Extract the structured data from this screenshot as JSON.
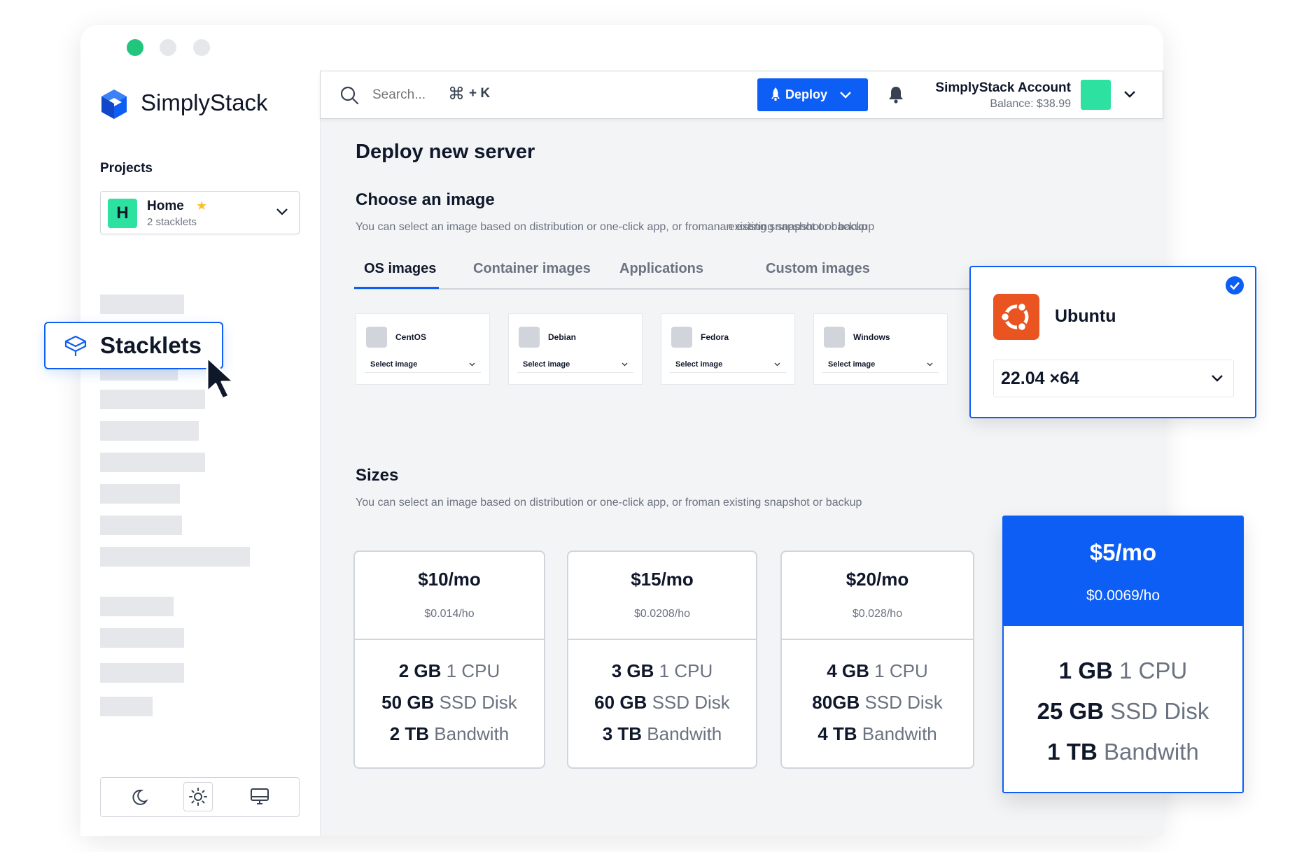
{
  "brand": {
    "name": "SimplyStack",
    "accent": "#0d5ef5",
    "green": "#2de1a0"
  },
  "sidebar": {
    "projects_heading": "Projects",
    "project": {
      "initial": "H",
      "name": "Home",
      "subtitle": "2 stacklets"
    },
    "active_item": "Stacklets",
    "theme_buttons": [
      "moon-icon",
      "sun-icon",
      "monitor-icon"
    ]
  },
  "topbar": {
    "search_placeholder": "Search...",
    "shortcut": "+ K",
    "deploy_label": "Deploy",
    "account_name": "SimplyStack Account",
    "balance": "Balance: $38.99"
  },
  "page": {
    "title": "Deploy new server",
    "image_section": {
      "heading": "Choose an image",
      "description_main": "You can select an image based on distribution or one-click app, or froman",
      "description_overlap_a": "an existing snapshot or backup",
      "description_overlap_b": "existing snapshot or backup",
      "tabs": [
        "OS images",
        "Container images",
        "Applications",
        "Custom images"
      ],
      "active_tab": "OS images",
      "os_options": [
        {
          "name": "CentOS",
          "select_label": "Select image"
        },
        {
          "name": "Debian",
          "select_label": "Select image"
        },
        {
          "name": "Fedora",
          "select_label": "Select image"
        },
        {
          "name": "Windows",
          "select_label": "Select image"
        }
      ],
      "selected_image": {
        "name": "Ubuntu",
        "version": "22.04 ×64"
      }
    },
    "sizes_section": {
      "heading": "Sizes",
      "description": "You can select an image based on distribution or one-click app, or froman existing snapshot or backup",
      "plans": [
        {
          "price": "$10/mo",
          "hourly": "$0.014/ho",
          "ram": "2 GB",
          "cpu": "1 CPU",
          "disk": "50 GB",
          "disk_label": "SSD Disk",
          "bw": "2 TB",
          "bw_label": "Bandwith"
        },
        {
          "price": "$15/mo",
          "hourly": "$0.0208/ho",
          "ram": "3 GB",
          "cpu": "1 CPU",
          "disk": "60 GB",
          "disk_label": "SSD Disk",
          "bw": "3 TB",
          "bw_label": "Bandwith"
        },
        {
          "price": "$20/mo",
          "hourly": "$0.028/ho",
          "ram": "4 GB",
          "cpu": "1 CPU",
          "disk": "80GB",
          "disk_label": "SSD Disk",
          "bw": "4 TB",
          "bw_label": "Bandwith"
        }
      ],
      "selected_plan": {
        "price": "$5/mo",
        "hourly": "$0.0069/ho",
        "ram": "1 GB",
        "cpu": "1 CPU",
        "disk": "25 GB",
        "disk_label": "SSD Disk",
        "bw": "1 TB",
        "bw_label": "Bandwith"
      }
    }
  }
}
